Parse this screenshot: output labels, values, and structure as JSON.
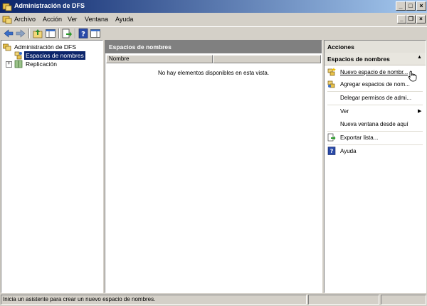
{
  "window": {
    "title": "Administración de DFS"
  },
  "menu": [
    "Archivo",
    "Acción",
    "Ver",
    "Ventana",
    "Ayuda"
  ],
  "tree": {
    "root_label": "Administración de DFS",
    "items": [
      {
        "label": "Espacios de nombres",
        "selected": true
      },
      {
        "label": "Replicación",
        "selected": false
      }
    ]
  },
  "center": {
    "header": "Espacios de nombres",
    "columns": [
      "Nombre"
    ],
    "empty_message": "No hay elementos disponibles en esta vista."
  },
  "actions": {
    "title": "Acciones",
    "section_title": "Espacios de nombres",
    "items": [
      {
        "label": "Nuevo espacio de nombr...",
        "icon": "new-namespace-icon"
      },
      {
        "label": "Agregar espacios de nom...",
        "icon": "add-namespace-icon"
      },
      {
        "label": "Delegar permisos de admi...",
        "icon": ""
      },
      {
        "label": "Ver",
        "icon": "",
        "submenu": true
      },
      {
        "label": "Nueva ventana desde aquí",
        "icon": ""
      },
      {
        "label": "Exportar lista...",
        "icon": "export-icon"
      },
      {
        "label": "Ayuda",
        "icon": "help-icon"
      }
    ]
  },
  "status": {
    "text": "Inicia un asistente para crear un nuevo espacio de nombres."
  },
  "colors": {
    "title_start": "#0a246a",
    "title_end": "#a6caf0",
    "selection": "#0a246a"
  }
}
